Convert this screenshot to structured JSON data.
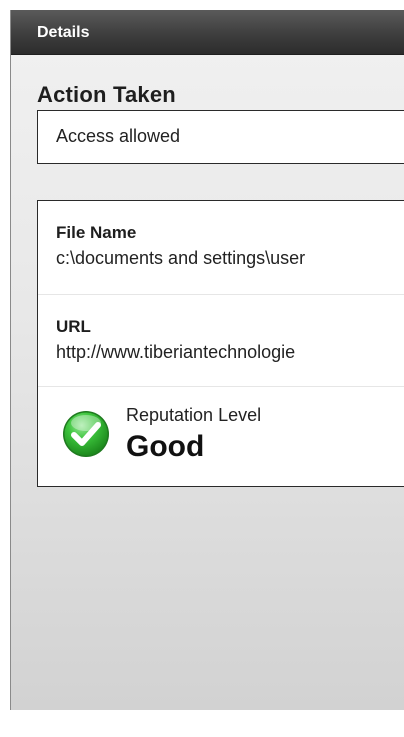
{
  "header": {
    "title": "Details"
  },
  "action": {
    "label": "Action Taken",
    "value": "Access allowed"
  },
  "file": {
    "label": "File Name",
    "value": "c:\\documents and settings\\user"
  },
  "url": {
    "label": "URL",
    "value": "http://www.tiberiantechnologie"
  },
  "reputation": {
    "label": "Reputation Level",
    "value": "Good",
    "icon": "green-checkmark-icon",
    "status_color": "#2fb42f"
  },
  "colors": {
    "header_bg": "#3e3e3e",
    "header_text": "#ffffff",
    "panel_bg": "#e8e8e8",
    "box_border": "#2a2a2a"
  }
}
